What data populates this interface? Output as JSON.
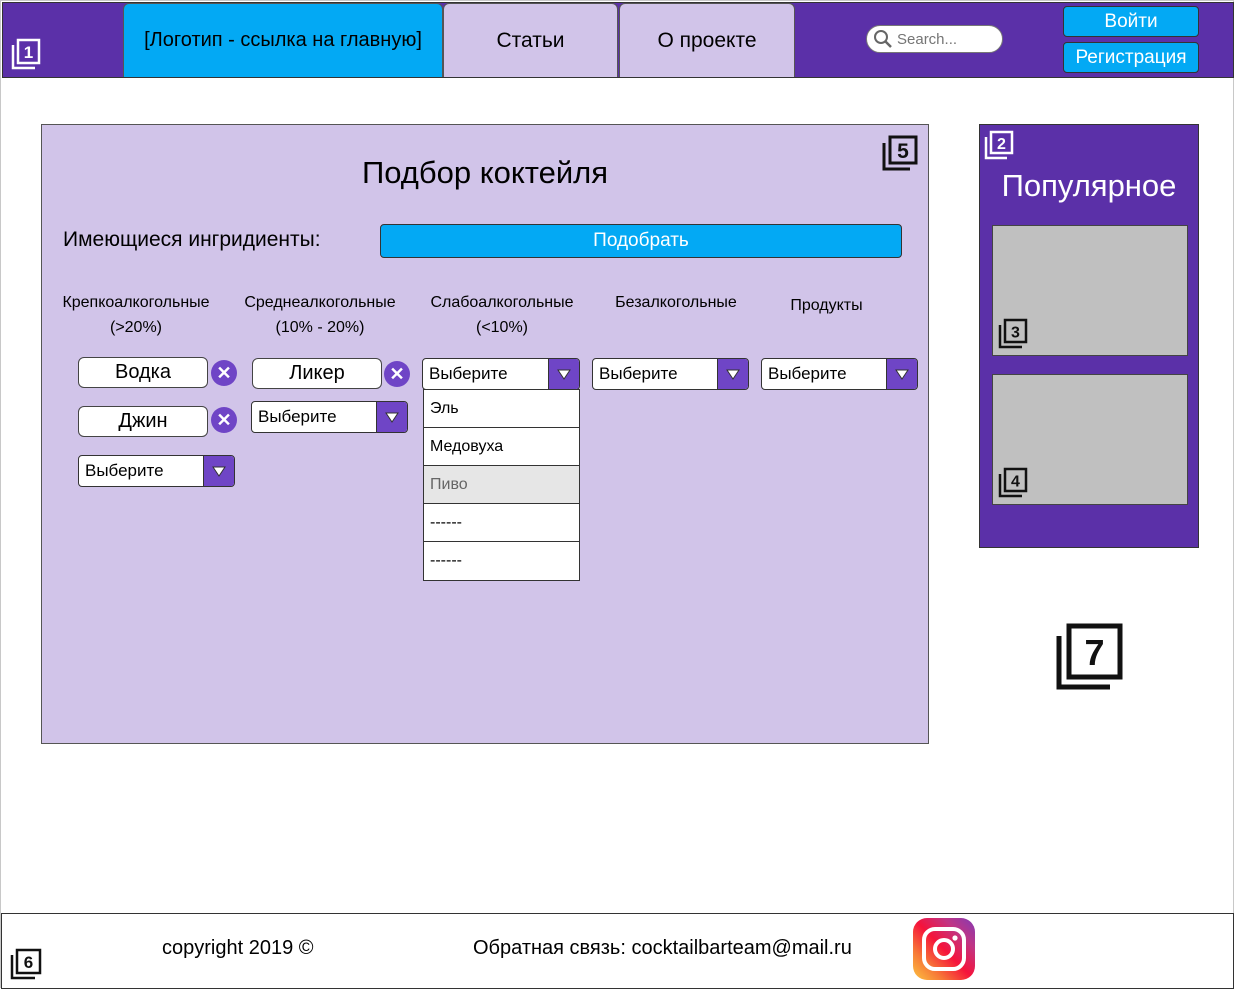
{
  "header": {
    "logo_tab": "[Логотип - ссылка на главную]",
    "tabs": [
      {
        "label": "Статьи"
      },
      {
        "label": "О проекте"
      }
    ],
    "search_placeholder": "Search...",
    "login_label": "Войти",
    "register_label": "Регистрация"
  },
  "badges": {
    "header": "1",
    "popular": "2",
    "popular_item_1": "3",
    "popular_item_2": "4",
    "main": "5",
    "footer": "6",
    "extra": "7"
  },
  "main": {
    "title": "Подбор коктейля",
    "ingredients_label": "Имеющиеся ингридиенты:",
    "pick_button": "Подобрать",
    "columns": [
      {
        "name": "Крепкоалкогольные",
        "range": "(>20%)"
      },
      {
        "name": "Среднеалкогольные",
        "range": "(10% - 20%)"
      },
      {
        "name": "Слабоалкогольные",
        "range": "(<10%)"
      },
      {
        "name": "Безалкогольные",
        "range": ""
      },
      {
        "name": "Продукты",
        "range": ""
      }
    ],
    "strong_chips": [
      "Водка",
      "Джин"
    ],
    "medium_chips": [
      "Ликер"
    ],
    "select_placeholder": "Выберите",
    "weak_dropdown_options": [
      "Эль",
      "Медовуха",
      "Пиво",
      "------",
      "------"
    ],
    "highlighted_option": "Пиво"
  },
  "sidebar": {
    "title": "Популярное"
  },
  "footer": {
    "copyright": "copyright 2019 ©",
    "feedback": "Обратная связь: cocktailbarteam@mail.ru"
  },
  "colors": {
    "header_purple": "#5b30a8",
    "panel_lilac": "#d1c4e9",
    "accent_blue": "#03a9f4",
    "select_arrow": "#6f45c6"
  },
  "icons": [
    "numbered-badge-icon",
    "search-icon",
    "remove-icon",
    "dropdown-arrow-icon",
    "instagram-icon"
  ]
}
